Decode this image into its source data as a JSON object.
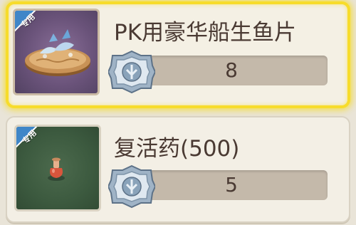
{
  "items": [
    {
      "tag": "专用",
      "name": "PK用豪华船生鱼片",
      "count": "8",
      "selected": true,
      "image_icon": "sashimi-boat-icon"
    },
    {
      "tag": "专用",
      "name": "复活药(500)",
      "count": "5",
      "selected": false,
      "image_icon": "potion-bottle-icon"
    }
  ],
  "colors": {
    "selected_border": "#f7dc2b",
    "tag_blue": "#3f86c8",
    "text": "#4a3a33",
    "count_bar": "#c4b9aa"
  }
}
